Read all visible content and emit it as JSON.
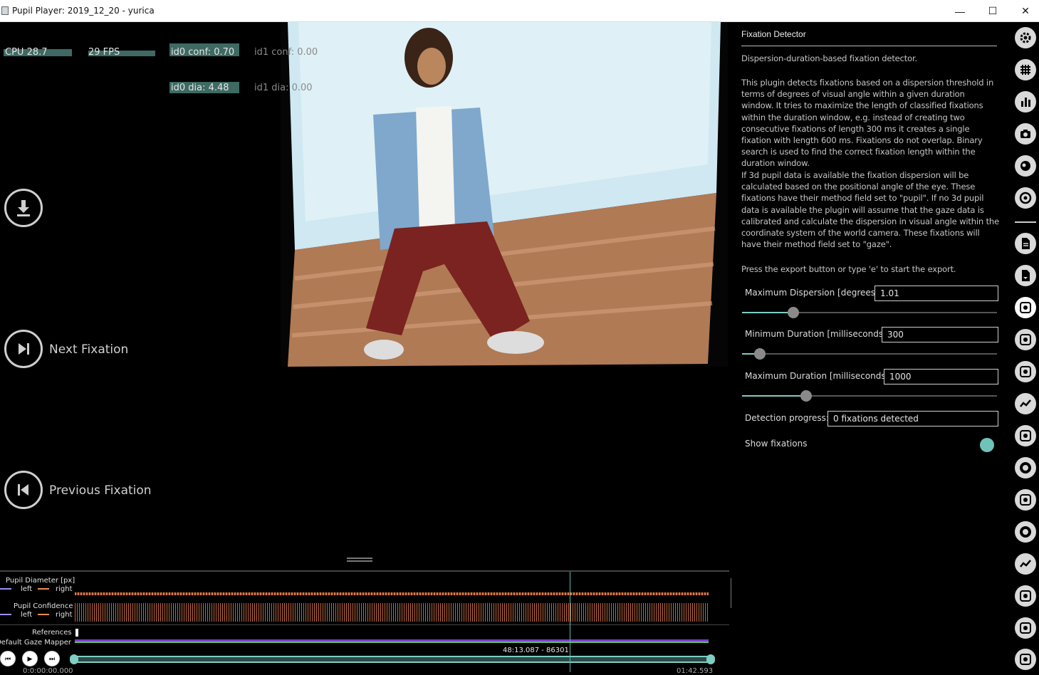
{
  "window": {
    "title": "Pupil Player: 2019_12_20 - yurica",
    "minimize": "—",
    "maximize": "☐",
    "close": "✕"
  },
  "stats": {
    "cpu": "CPU 28.7",
    "fps": "29 FPS",
    "id0_conf": "id0 conf: 0.70",
    "id1_conf": "id1 conf: 0.00",
    "id0_dia": "id0 dia: 4.48",
    "id1_dia": "id1 dia: 0.00"
  },
  "overlay_buttons": {
    "next_fixation": "Next Fixation",
    "previous_fixation": "Previous Fixation"
  },
  "timeline": {
    "pupil_diameter_label": "Pupil Diameter [px]",
    "pupil_confidence_label": "Pupil Confidence",
    "left": "left",
    "right": "right",
    "references_label": "References",
    "gaze_mapper_label": "Default Gaze Mapper",
    "frame_readout": "48:13.087 - 86301",
    "start_time": "0:0:00:00.000",
    "end_time": "01:42.593",
    "colors": {
      "left": "#9b8ff0",
      "right": "#f08a5a",
      "accent": "#7fcdc4"
    }
  },
  "panel": {
    "title": "Fixation Detector",
    "description": "Dispersion-duration-based fixation detector.",
    "paragraph1": "This plugin detects fixations based on a dispersion threshold in terms of degrees of visual angle within a given duration window. It tries to maximize the length of classified fixations within the duration window, e.g. instead of creating two consecutive fixations of length 300 ms it creates a single fixation with length 600 ms. Fixations do not overlap. Binary search is used to find the correct fixation length within the duration window.",
    "paragraph2": "If 3d pupil data is available the fixation dispersion will be calculated based on the positional angle of the eye. These fixations have their method field set to \"pupil\". If no 3d pupil data is available the plugin will assume that the gaze data is calibrated and calculate the dispersion in visual angle within the coordinate system of the world camera. These fixations will have their method field set to \"gaze\".",
    "paragraph3": "Press the export button or type 'e' to start the export.",
    "max_dispersion_label": "Maximum Dispersion [degrees]",
    "max_dispersion_value": "1.01",
    "min_duration_label": "Minimum Duration [milliseconds]",
    "min_duration_value": "300",
    "max_duration_label": "Maximum Duration [milliseconds]",
    "max_duration_value": "1000",
    "progress_label": "Detection progress:",
    "progress_value": "0 fixations detected",
    "show_fixations_label": "Show fixations",
    "show_fixations_enabled": true,
    "slider_levels": {
      "max_dispersion": 0.2,
      "min_duration": 0.07,
      "max_duration": 0.25
    }
  },
  "sidebar_icons": [
    "gear-icon",
    "grid-icon",
    "bar-chart-icon",
    "camera-icon",
    "eye-icon",
    "target-icon",
    "document-icon",
    "document-export-icon",
    "fixation-detector-icon",
    "plugin-icon",
    "plugin-icon",
    "line-chart-icon",
    "plugin-icon",
    "ring-icon",
    "plugin-icon",
    "ring-icon",
    "line-chart-icon",
    "plugin-icon",
    "plugin-icon",
    "plugin-icon"
  ]
}
